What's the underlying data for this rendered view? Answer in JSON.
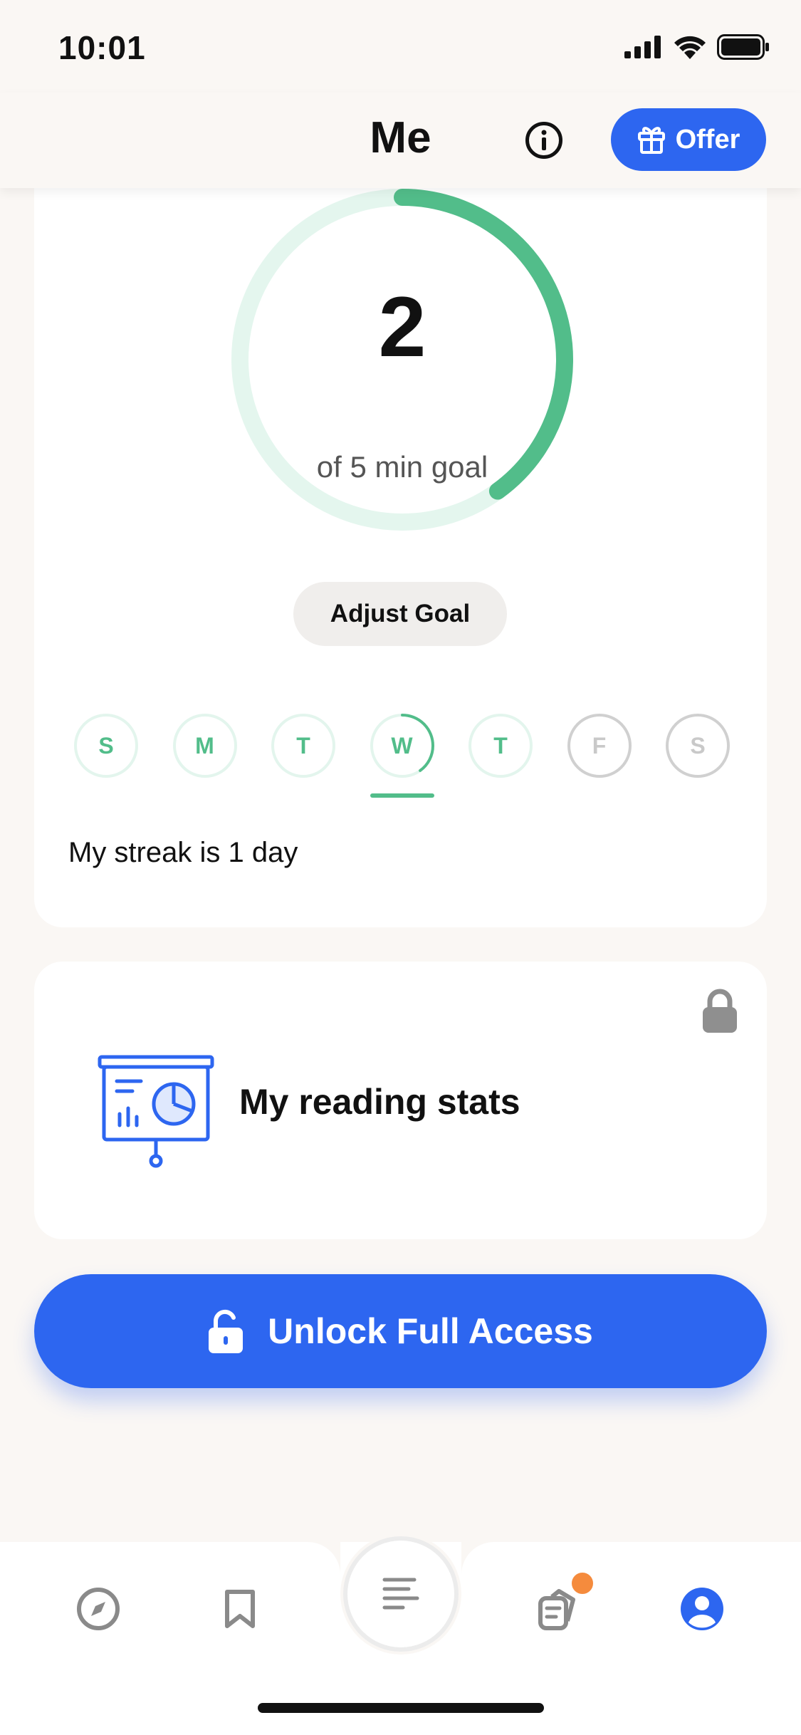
{
  "status_bar": {
    "time": "10:01"
  },
  "header": {
    "title": "Me",
    "offer_label": "Offer"
  },
  "goal_card": {
    "minutes_done": "2",
    "goal_caption": "of 5 min goal",
    "progress_fraction": 0.4,
    "adjust_label": "Adjust Goal",
    "days": [
      {
        "label": "S",
        "state": "done"
      },
      {
        "label": "M",
        "state": "done"
      },
      {
        "label": "T",
        "state": "done"
      },
      {
        "label": "W",
        "state": "today"
      },
      {
        "label": "T",
        "state": "done"
      },
      {
        "label": "F",
        "state": "future"
      },
      {
        "label": "S",
        "state": "future"
      }
    ],
    "streak_text": "My streak is 1 day"
  },
  "stats_card": {
    "label": "My reading stats"
  },
  "unlock": {
    "label": "Unlock Full Access"
  },
  "tab_bar": {
    "items": [
      "compass-icon",
      "bookmark-icon",
      "reader-icon",
      "notes-icon",
      "profile-icon"
    ],
    "active": "profile-icon"
  },
  "colors": {
    "accent": "#2d66f0",
    "progress": "#52bd8a",
    "notification": "#f58b3d"
  }
}
